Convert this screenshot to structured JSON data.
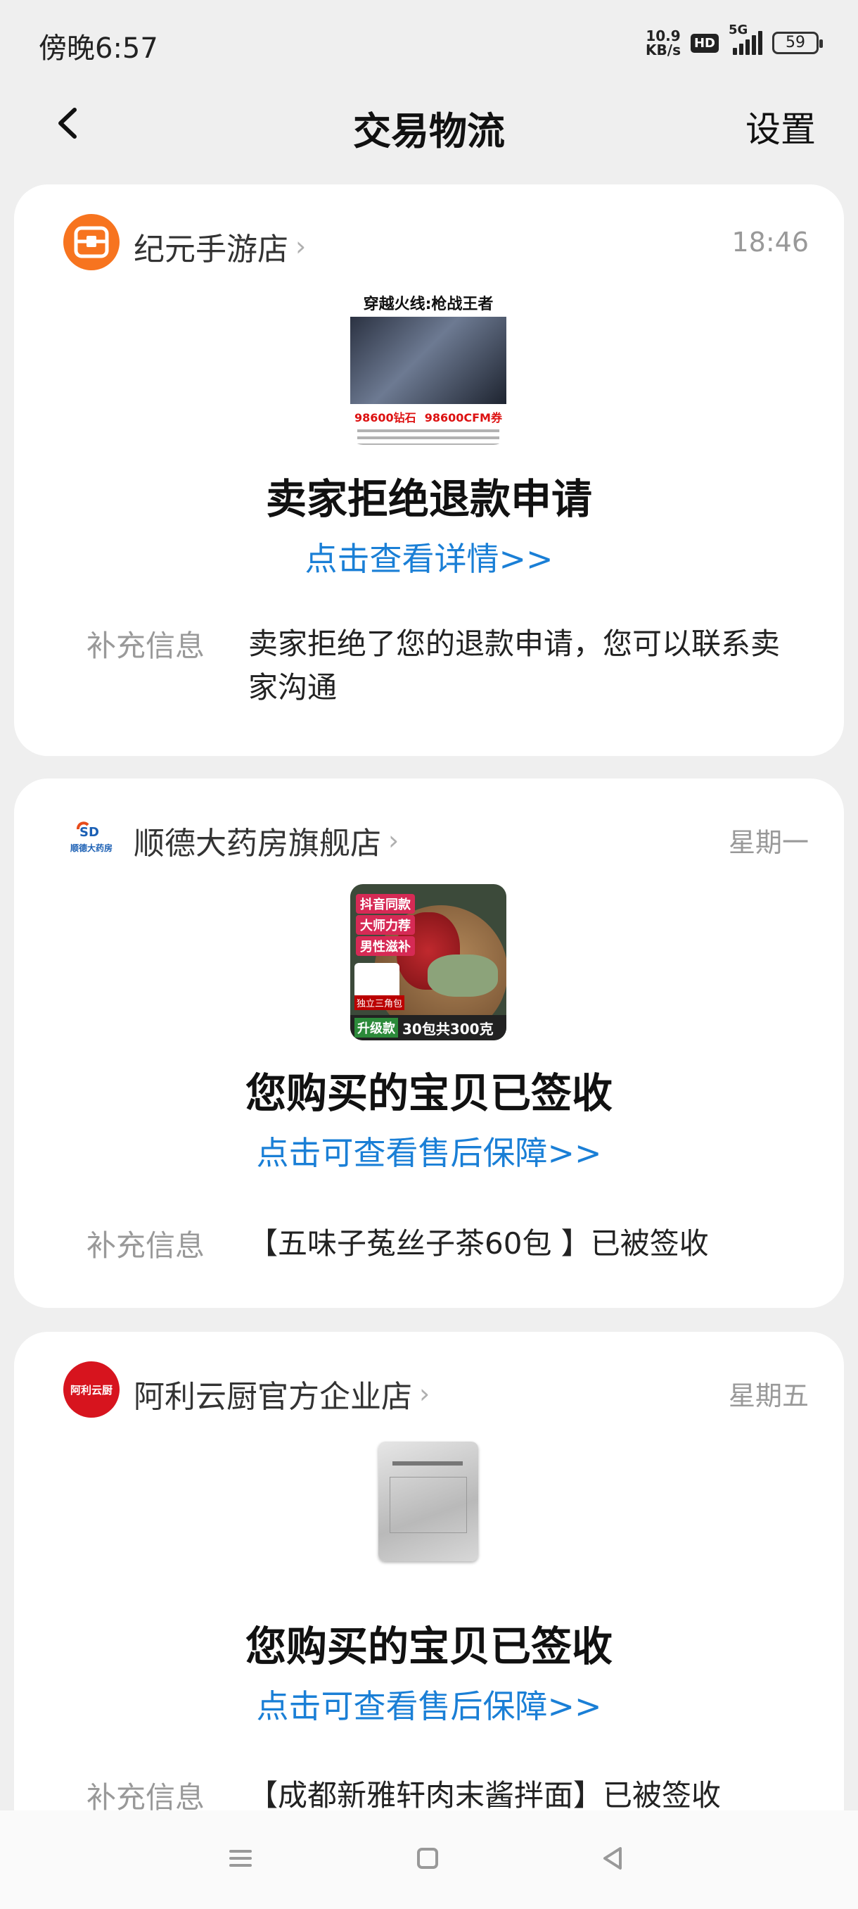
{
  "status_bar": {
    "time": "傍晚6:57",
    "net_speed_value": "10.9",
    "net_speed_unit": "KB/s",
    "hd_label": "HD",
    "signal_label": "5G",
    "battery": "59"
  },
  "header": {
    "title": "交易物流",
    "settings_label": "设置",
    "back_icon": "chevron-left-icon"
  },
  "messages": [
    {
      "shop_name": "纪元手游店",
      "time": "18:46",
      "logo_color": "#f7741f",
      "product_image_lines": [
        "穿越火线:枪战王者",
        "98600钻石",
        "98600CFM券"
      ],
      "title": "卖家拒绝退款申请",
      "link": "点击查看详情>>",
      "extra_label": "补充信息",
      "extra_text": "卖家拒绝了您的退款申请，您可以联系卖家沟通"
    },
    {
      "shop_name": "顺德大药房旗舰店",
      "time": "星期一",
      "logo_text": "顺德大药房",
      "product_image_lines": [
        "抖音同款",
        "大师力荐",
        "男性滋补",
        "独立三角包",
        "升级款",
        "30包共300克"
      ],
      "title": "您购买的宝贝已签收",
      "link": "点击可查看售后保障>>",
      "extra_label": "补充信息",
      "extra_text": "【五味子菟丝子茶60包 】已被签收"
    },
    {
      "shop_name": "阿利云厨官方企业店",
      "time": "星期五",
      "logo_color": "#d7141e",
      "logo_text": "阿利云厨",
      "title": "您购买的宝贝已签收",
      "link": "点击可查看售后保障>>",
      "extra_label": "补充信息",
      "extra_text": "【成都新雅轩肉末酱拌面】已被签收"
    }
  ],
  "colors": {
    "link": "#1a7fd6",
    "background": "#efefef",
    "card": "#ffffff"
  },
  "bottom_nav": [
    "menu-icon",
    "home-square-icon",
    "back-triangle-icon"
  ]
}
